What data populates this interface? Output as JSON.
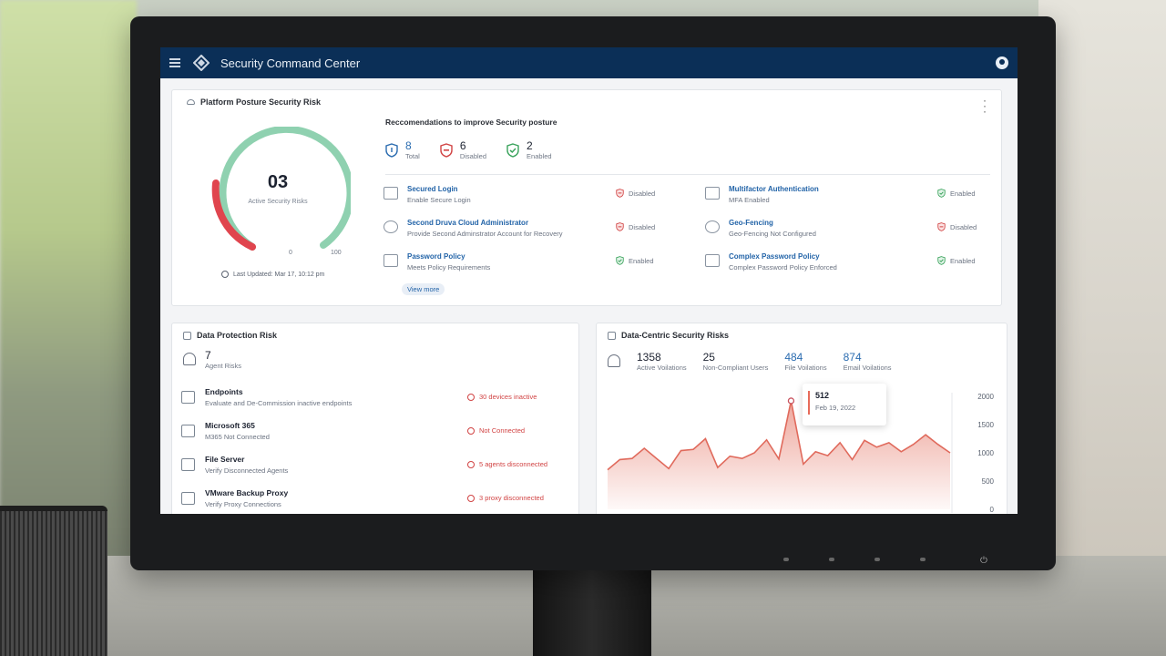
{
  "app": {
    "title": "Security Command Center"
  },
  "posture": {
    "title": "Platform Posture Security Risk",
    "gauge_value": "03",
    "gauge_label": "Active Security Risks",
    "gauge_min": "0",
    "gauge_max": "100",
    "last_updated": "Last Updated: Mar 17, 10:12 pm",
    "rec_title": "Reccomendations to improve Security posture",
    "stats": [
      {
        "value": "8",
        "label": "Total"
      },
      {
        "value": "6",
        "label": "Disabled"
      },
      {
        "value": "2",
        "label": "Enabled"
      }
    ],
    "recommendations": [
      {
        "name": "Secured Login",
        "desc": "Enable Secure Login",
        "status": "Disabled"
      },
      {
        "name": "Multifactor Authentication",
        "desc": "MFA Enabled",
        "status": "Enabled"
      },
      {
        "name": "Second Druva Cloud Administrator",
        "desc": "Provide Second Adminstrator Account for Recovery",
        "status": "Disabled"
      },
      {
        "name": "Geo-Fencing",
        "desc": "Geo-Fencing Not Configured",
        "status": "Disabled"
      },
      {
        "name": "Password Policy",
        "desc": "Meets Policy Requirements",
        "status": "Enabled"
      },
      {
        "name": "Complex Password Policy",
        "desc": "Complex Password Policy Enforced",
        "status": "Enabled"
      }
    ],
    "view_more": "View more"
  },
  "data_protection": {
    "title": "Data Protection Risk",
    "agent_risks_value": "7",
    "agent_risks_label": "Agent Risks",
    "rows": [
      {
        "name": "Endpoints",
        "desc": "Evaluate and De-Commission inactive endpoints",
        "status": "30 devices inactive"
      },
      {
        "name": "Microsoft 365",
        "desc": "M365 Not Connected",
        "status": "Not Connected"
      },
      {
        "name": "File Server",
        "desc": "Verify Disconnected Agents",
        "status": "5 agents disconnected"
      },
      {
        "name": "VMware Backup Proxy",
        "desc": "Verify Proxy Connections",
        "status": "3 proxy disconnected"
      }
    ]
  },
  "data_centric": {
    "title": "Data-Centric Security Risks",
    "stats": [
      {
        "value": "1358",
        "label": "Active Voilations"
      },
      {
        "value": "25",
        "label": "Non-Compliant Users"
      },
      {
        "value": "484",
        "label": "File Voilations"
      },
      {
        "value": "874",
        "label": "Email Voilations"
      }
    ],
    "tooltip": {
      "value": "512",
      "date": "Feb 19, 2022"
    }
  },
  "chart_data": {
    "type": "area",
    "y_ticks": [
      "2000",
      "1500",
      "1000",
      "500",
      "0"
    ],
    "ylim": [
      0,
      2000
    ],
    "values": [
      700,
      880,
      900,
      1080,
      900,
      720,
      1040,
      1060,
      1250,
      740,
      940,
      900,
      1000,
      1230,
      890,
      1920,
      800,
      1020,
      950,
      1180,
      880,
      1220,
      1100,
      1180,
      1020,
      1150,
      1320,
      1150,
      1000
    ],
    "color": "#e8887a"
  }
}
